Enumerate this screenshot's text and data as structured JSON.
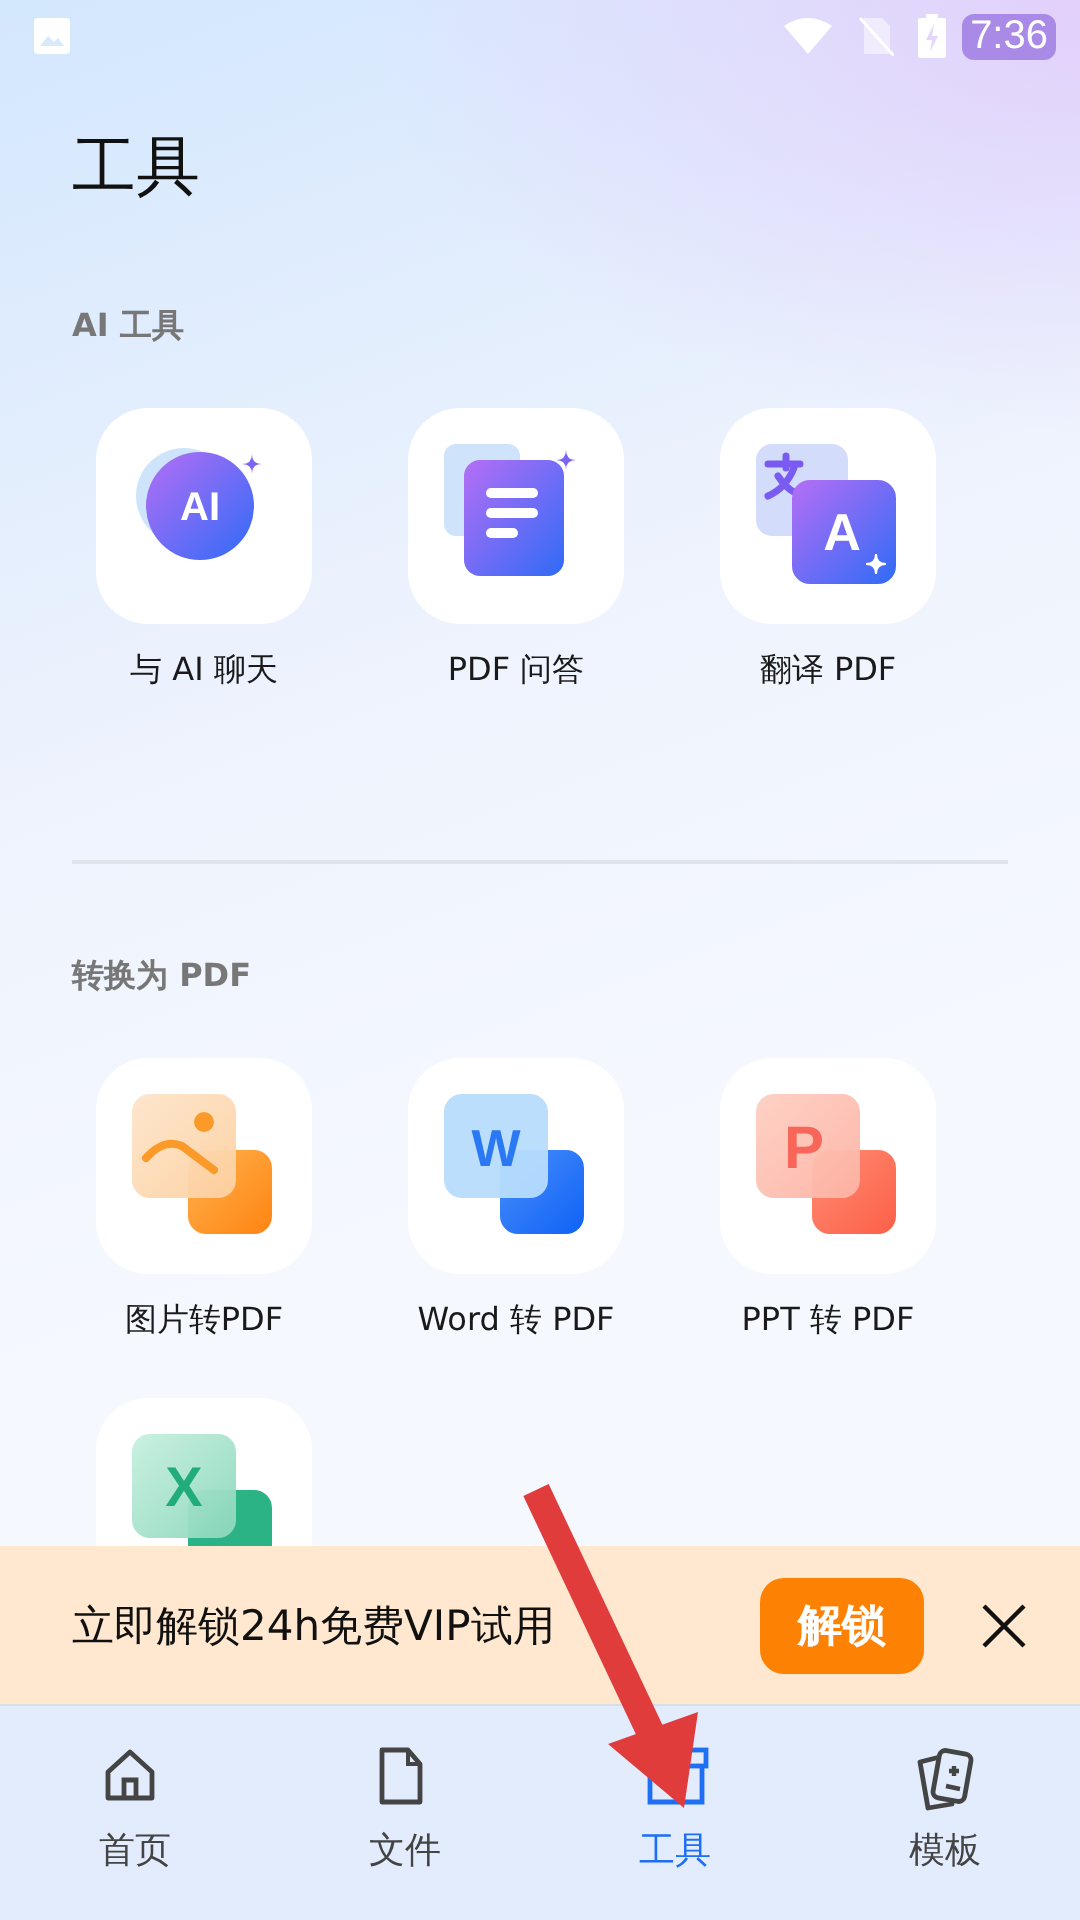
{
  "status_bar": {
    "time": "7:36"
  },
  "page_title": "工具",
  "sections": [
    {
      "title": "AI 工具",
      "tools": [
        {
          "kind": "ai-chat",
          "icon_text": "AI",
          "label": "与 AI 聊天"
        },
        {
          "kind": "pdf-qa",
          "label": "PDF 问答"
        },
        {
          "kind": "translate",
          "icon_text": "A",
          "label": "翻译 PDF"
        }
      ]
    },
    {
      "title": "转换为 PDF",
      "tools": [
        {
          "kind": "image",
          "label": "图片转PDF"
        },
        {
          "kind": "word",
          "icon_text": "W",
          "label": "Word 转 PDF"
        },
        {
          "kind": "ppt",
          "icon_text": "P",
          "label": "PPT 转 PDF"
        },
        {
          "kind": "excel",
          "icon_text": "X"
        }
      ]
    }
  ],
  "promo_banner": {
    "text": "立即解锁24h免费VIP试用",
    "button": "解锁"
  },
  "bottom_nav": [
    {
      "kind": "home",
      "label": "首页",
      "selected": false
    },
    {
      "kind": "file",
      "label": "文件",
      "selected": false
    },
    {
      "kind": "tools",
      "label": "工具",
      "selected": true
    },
    {
      "kind": "templates",
      "label": "模板",
      "selected": false
    }
  ]
}
